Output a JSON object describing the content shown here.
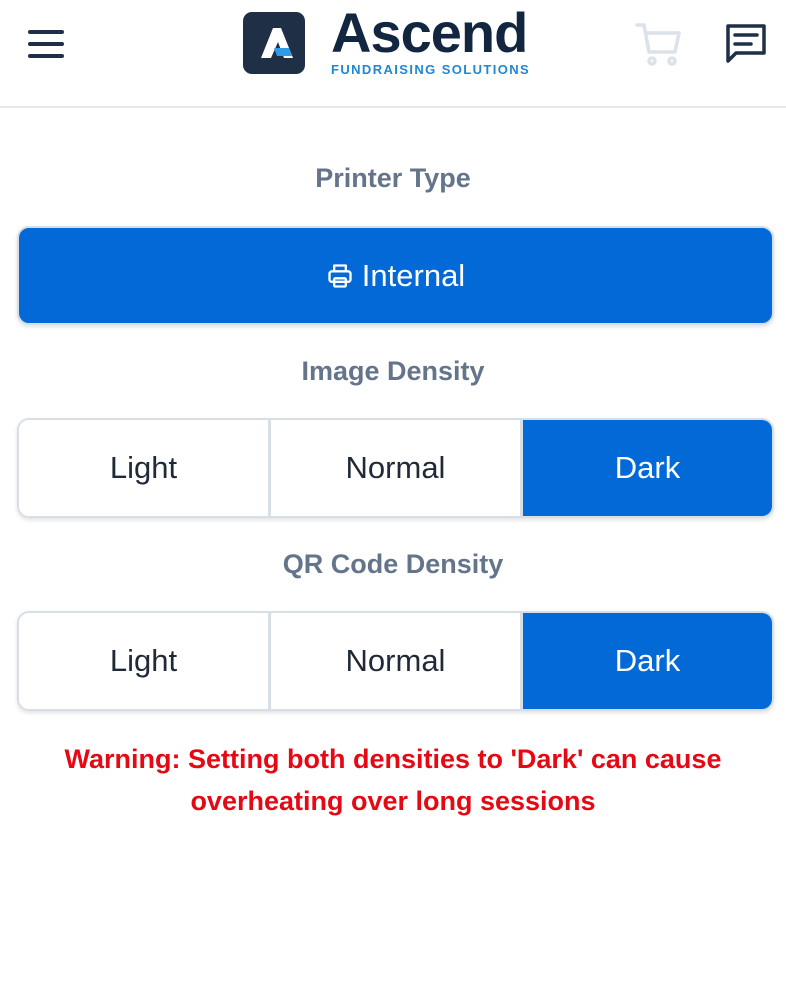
{
  "header": {
    "brand_name": "Ascend",
    "brand_tagline": "FUNDRAISING SOLUTIONS",
    "menu_icon": "hamburger-menu-icon",
    "cart_icon": "shopping-cart-icon",
    "chat_icon": "message-icon"
  },
  "printer_type": {
    "title": "Printer Type",
    "selected_label": "Internal",
    "icon": "printer-icon"
  },
  "image_density": {
    "title": "Image Density",
    "options": [
      "Light",
      "Normal",
      "Dark"
    ],
    "selected": "Dark"
  },
  "qr_density": {
    "title": "QR Code Density",
    "options": [
      "Light",
      "Normal",
      "Dark"
    ],
    "selected": "Dark"
  },
  "warning": "Warning: Setting both densities to 'Dark' can cause overheating over long sessions",
  "colors": {
    "accent": "#0369d6",
    "navy": "#1f2f46",
    "warning": "#e50914",
    "muted_text": "#64748b"
  }
}
